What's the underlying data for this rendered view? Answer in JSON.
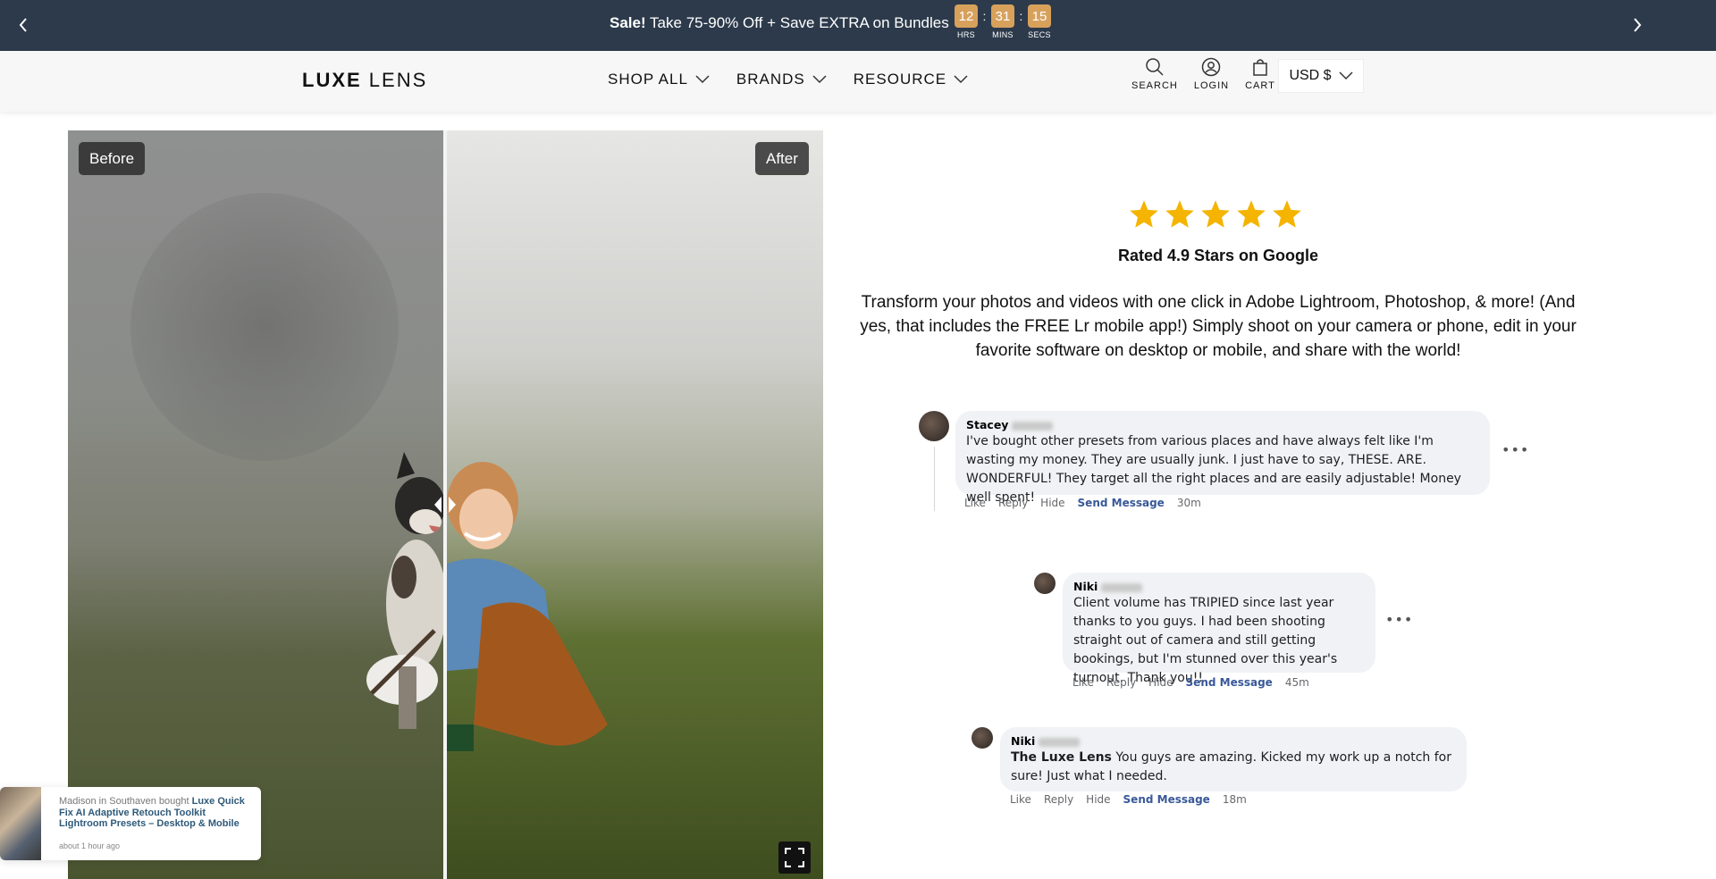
{
  "announcement": {
    "sale_label": "Sale!",
    "text": " Take 75-90% Off + Save EXTRA on Bundles",
    "timer": {
      "hours": "12",
      "hours_label": "HRS",
      "mins": "31",
      "mins_label": "MINS",
      "secs": "15",
      "secs_label": "SECS"
    }
  },
  "header": {
    "logo_bold": "LUXE",
    "logo_light": " LENS",
    "nav": [
      "SHOP ALL",
      "BRANDS",
      "RESOURCE"
    ],
    "icons": {
      "search": "SEARCH",
      "login": "LOGIN",
      "cart": "CART"
    },
    "currency": "USD $"
  },
  "compare": {
    "before_label": "Before",
    "after_label": "After",
    "divider_position": 0.5
  },
  "rating": {
    "stars": 5,
    "star_color": "#f4b400",
    "text": "Rated 4.9 Stars on Google"
  },
  "description": "Transform your photos and videos with one click in Adobe Lightroom, Photoshop, & more! (And yes, that includes the FREE Lr mobile app!) Simply shoot on your camera or phone, edit in your favorite software on desktop or mobile, and share with the world!",
  "comments": [
    {
      "name": "Stacey",
      "text": "I've bought other presets from various places and have always felt like I'm wasting my money. They are usually junk. I just have to say, THESE. ARE. WONDERFUL! They target all the right places and are easily adjustable! Money well spent!",
      "actions": [
        "Like",
        "Reply",
        "Hide"
      ],
      "send_message": "Send Message",
      "time": "30m"
    },
    {
      "name": "Niki",
      "text": "Client volume has TRIPIED since last year thanks to you guys. I had been shooting straight out of camera and still getting bookings, but I'm stunned over this year's turnout. Thank you!!",
      "actions": [
        "Like",
        "Reply",
        "Hide"
      ],
      "send_message": "Send Message",
      "time": "45m"
    },
    {
      "name": "Niki",
      "tagged": "The Luxe Lens",
      "text": " You guys are amazing. Kicked my work up a notch for sure! Just what I needed.",
      "actions": [
        "Like",
        "Reply",
        "Hide"
      ],
      "send_message": "Send Message",
      "time": "18m"
    }
  ],
  "purchase_popup": {
    "prefix": "Madison in Southaven bought ",
    "product": "Luxe Quick Fix AI Adaptive Retouch Toolkit Lightroom Presets – Desktop & Mobile",
    "time": "about 1 hour ago"
  }
}
